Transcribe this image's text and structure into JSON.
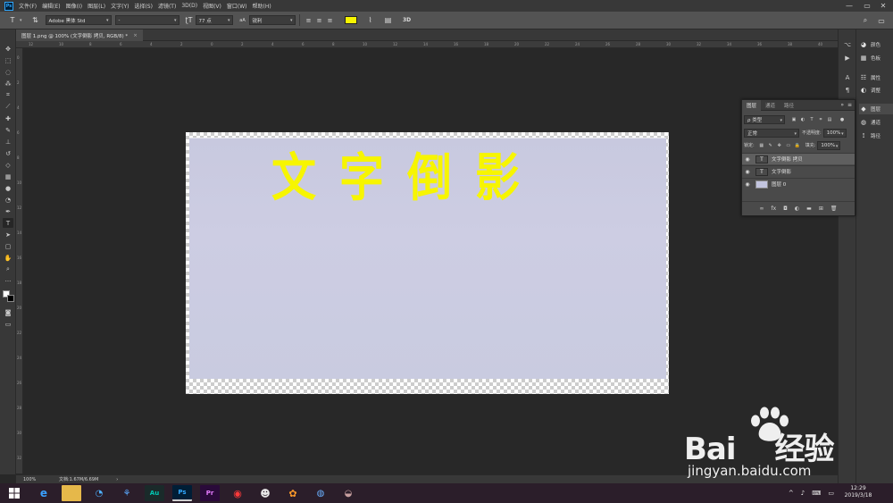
{
  "menubar": {
    "logo": "Ps",
    "items": [
      "文件(F)",
      "编辑(E)",
      "图像(I)",
      "图层(L)",
      "文字(Y)",
      "选择(S)",
      "滤镜(T)",
      "3D(D)",
      "视图(V)",
      "窗口(W)",
      "帮助(H)"
    ],
    "win_controls": [
      "—",
      "▭",
      "✕"
    ]
  },
  "options_bar": {
    "tool_glyph": "T",
    "font_family": "Adobe 黑体 Std",
    "font_style": "-",
    "font_size": "77 点",
    "aa_icon": "aA",
    "antialias": "锐利",
    "color_swatch": "#f7f500",
    "three_d": "3D"
  },
  "document": {
    "tab_title": "图层 1.png @ 100% (文字倒影 拷贝, RGB/8) *",
    "close": "×",
    "text": "文字倒影",
    "text_color": "#f7f500"
  },
  "ruler": {
    "top_ticks": [
      "12",
      "10",
      "8",
      "6",
      "4",
      "2",
      "0",
      "2",
      "4",
      "6",
      "8",
      "10",
      "12",
      "14",
      "16",
      "18",
      "20",
      "22",
      "24",
      "26",
      "28",
      "30",
      "32",
      "34",
      "36",
      "38",
      "40"
    ],
    "left_ticks": [
      "0",
      "2",
      "4",
      "6",
      "8",
      "10",
      "12",
      "14",
      "16",
      "18",
      "20",
      "22",
      "24",
      "26",
      "28",
      "30",
      "32"
    ]
  },
  "status": {
    "zoom": "100%",
    "doc_info": "文档:1.67M/6.69M",
    "arrow": "›"
  },
  "right_dock": {
    "items": [
      {
        "icon": "palette-icon",
        "label": "颜色"
      },
      {
        "icon": "grid-icon",
        "label": "色板"
      },
      {
        "icon": "sliders-icon",
        "label": "属性"
      },
      {
        "icon": "adjust-icon",
        "label": "调整"
      },
      {
        "icon": "layers-icon",
        "label": "图层"
      },
      {
        "icon": "channels-icon",
        "label": "通道"
      },
      {
        "icon": "paths-icon",
        "label": "路径"
      }
    ]
  },
  "layers_panel": {
    "tabs": [
      "图层",
      "通道",
      "路径"
    ],
    "filter_label": "ρ 类型",
    "blend_mode": "正常",
    "opacity_label": "不透明度:",
    "opacity_value": "100%",
    "lock_label": "锁定:",
    "fill_label": "填充:",
    "fill_value": "100%",
    "layers": [
      {
        "name": "文字倒影 拷贝",
        "type": "T",
        "selected": true
      },
      {
        "name": "文字倒影",
        "type": "T",
        "selected": false
      },
      {
        "name": "图层 0",
        "type": "image",
        "selected": false
      }
    ],
    "footer_icons": [
      "link-icon",
      "fx-icon",
      "mask-icon",
      "adjustment-icon",
      "folder-icon",
      "new-layer-icon",
      "trash-icon"
    ],
    "footer_glyphs": [
      "∞",
      "fx",
      "◘",
      "◐",
      "▬",
      "⊞",
      "🗑"
    ]
  },
  "taskbar": {
    "apps": [
      {
        "name": "Au",
        "color": "#00c8b4",
        "bg": "#1a2a2a",
        "running": false
      },
      {
        "name": "Ps",
        "color": "#31a8ff",
        "bg": "#001e36",
        "running": true
      },
      {
        "name": "Pr",
        "color": "#e77cff",
        "bg": "#2a0a3a",
        "running": false
      }
    ],
    "clock_time": "12:29",
    "clock_date": "2019/3/18",
    "tray_icons": [
      "^",
      "♪",
      "⌨",
      "▭"
    ]
  },
  "watermark": {
    "main": "Bai",
    "main_cn": "经验",
    "sub": "jingyan.baidu.com"
  }
}
